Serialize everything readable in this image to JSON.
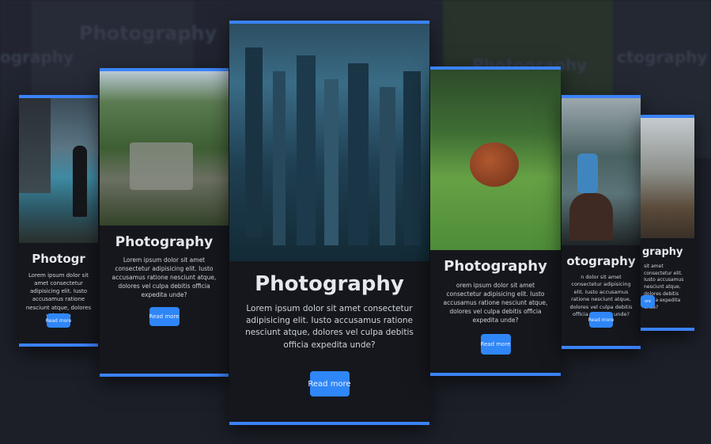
{
  "background": {
    "title_left": "Photography",
    "title_mid": "Photography",
    "title_right": "ctography",
    "title_far_left": "ography"
  },
  "cards": [
    {
      "title": "Photogr",
      "desc": "Lorem ipsum dolor sit amet consectetur adipisicing elit. Iusto accusamus ratione nesciunt atque, dolores vel culpa",
      "button": "Read more",
      "image": "person standing by lake"
    },
    {
      "title": "Photography",
      "desc": "Lorem ipsum dolor sit amet consectetur adipisicing elit. Iusto accusamus ratione nesciunt atque, dolores vel culpa debitis officia expedita unde?",
      "button": "Read more",
      "image": "mountain village"
    },
    {
      "title": "Photography",
      "desc": "Lorem ipsum dolor sit amet consectetur adipisicing elit. Iusto accusamus ratione nesciunt atque, dolores vel culpa debitis officia expedita unde?",
      "button": "Read more",
      "image": "city skyline at night"
    },
    {
      "title": "Photography",
      "desc": "orem ipsum dolor sit amet consectetur adipisicing elit. Iusto accusamus ratione nesciunt atque, dolores vel culpa debitis officia expedita unde?",
      "button": "Read more",
      "image": "football on grass"
    },
    {
      "title": "otography",
      "desc": "n dolor sit amet consectetur adipisicing elit. Iusto accusamus ratione nesciunt atque, dolores vel culpa debitis officia expedita unde?",
      "button": "Read more",
      "image": "person kayaking"
    },
    {
      "title": "graphy",
      "desc": "sit amet consectetur elit. Iusto accusamus nesciunt atque, dolores debitis officia expedita unde?",
      "button": "ore",
      "image": "bridge landscape"
    }
  ],
  "colors": {
    "accent": "#3b82f6",
    "button": "#2f86f6",
    "card": "#15171d",
    "page": "#1c1f28"
  }
}
